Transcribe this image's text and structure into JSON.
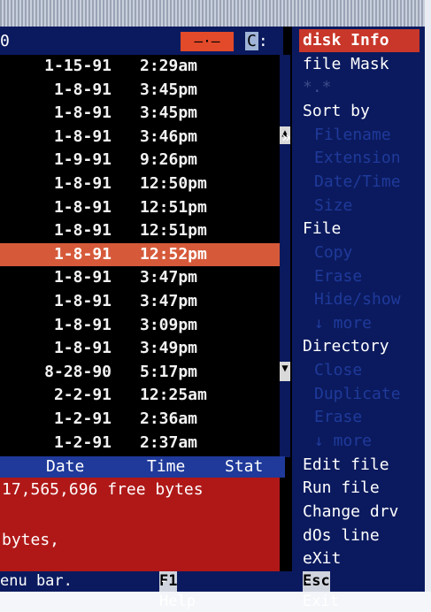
{
  "header": {
    "left": "0",
    "mid": "—·—",
    "drive": "C",
    "drive_suffix": ":"
  },
  "files": [
    {
      "date": "1-15-91",
      "time": "2:29am"
    },
    {
      "date": "1-8-91",
      "time": "3:45pm"
    },
    {
      "date": "1-8-91",
      "time": "3:45pm"
    },
    {
      "date": "1-8-91",
      "time": "3:46pm"
    },
    {
      "date": "1-9-91",
      "time": "9:26pm"
    },
    {
      "date": "1-8-91",
      "time": "12:50pm"
    },
    {
      "date": "1-8-91",
      "time": "12:51pm"
    },
    {
      "date": "1-8-91",
      "time": "12:51pm"
    },
    {
      "date": "1-8-91",
      "time": "12:52pm",
      "selected": true
    },
    {
      "date": "1-8-91",
      "time": "3:47pm"
    },
    {
      "date": "1-8-91",
      "time": "3:47pm"
    },
    {
      "date": "1-8-91",
      "time": "3:09pm"
    },
    {
      "date": "1-8-91",
      "time": "3:49pm"
    },
    {
      "date": "8-28-90",
      "time": "5:17pm"
    },
    {
      "date": "2-2-91",
      "time": "12:25am"
    },
    {
      "date": "1-2-91",
      "time": "2:36am"
    },
    {
      "date": "1-2-91",
      "time": "2:37am"
    }
  ],
  "columns": {
    "date": "Date",
    "time": "Time",
    "stat": "Stat"
  },
  "info": {
    "free": "17,565,696 free bytes",
    "bytes": "bytes,"
  },
  "menu": [
    {
      "label": "disk Info",
      "state": "highlight"
    },
    {
      "label": "file Mask",
      "state": "normal"
    },
    {
      "label": "*.*",
      "state": "dim"
    },
    {
      "label": "Sort by",
      "state": "normal"
    },
    {
      "label": "Filename",
      "state": "disabled"
    },
    {
      "label": "Extension",
      "state": "disabled"
    },
    {
      "label": "Date/Time",
      "state": "disabled"
    },
    {
      "label": "Size",
      "state": "disabled"
    },
    {
      "label": "File",
      "state": "normal"
    },
    {
      "label": "Copy",
      "state": "disabled"
    },
    {
      "label": "Erase",
      "state": "disabled"
    },
    {
      "label": "Hide/show",
      "state": "disabled"
    },
    {
      "label": "↓ more",
      "state": "disabled"
    },
    {
      "label": "Directory",
      "state": "normal"
    },
    {
      "label": "Close",
      "state": "disabled"
    },
    {
      "label": "Duplicate",
      "state": "disabled"
    },
    {
      "label": "Erase",
      "state": "disabled"
    },
    {
      "label": "↓ more",
      "state": "disabled"
    },
    {
      "label": "Edit file",
      "state": "normal"
    },
    {
      "label": "Run file",
      "state": "normal"
    },
    {
      "label": "Change drv",
      "state": "normal"
    },
    {
      "label": "dOs line",
      "state": "normal"
    },
    {
      "label": "eXit",
      "state": "normal"
    }
  ],
  "scroll_arrows": {
    "up": "▲",
    "down": "▼",
    "pointer": "»"
  },
  "bottom": {
    "left": "enu bar.",
    "f1_key": "F1",
    "f1_label": "-Help",
    "esc_key": "Esc",
    "esc_label": "-Exit"
  }
}
